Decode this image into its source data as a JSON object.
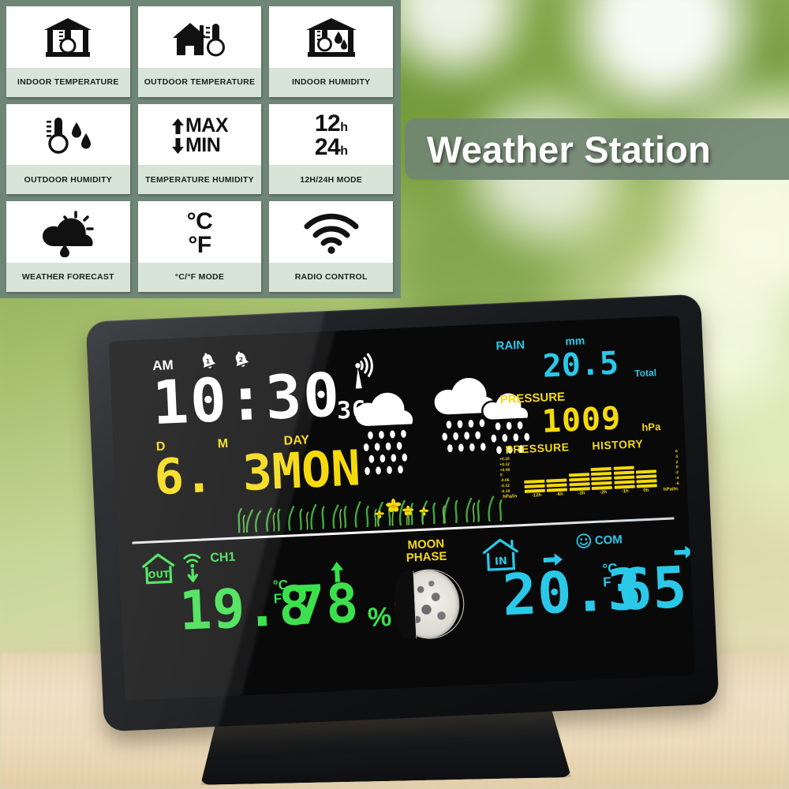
{
  "banner": {
    "title": "Weather Station",
    "bg_color": "#718572",
    "text_color": "#ffffff"
  },
  "features": [
    {
      "icon": "indoor-thermometer-icon",
      "label": "INDOOR TEMPERATURE"
    },
    {
      "icon": "house-thermometer-icon",
      "label": "OUTDOOR TEMPERATURE"
    },
    {
      "icon": "indoor-humidity-icon",
      "label": "INDOOR HUMIDITY"
    },
    {
      "icon": "thermometer-droplets-icon",
      "label": "OUTDOOR HUMIDITY"
    },
    {
      "icon": "max-min-arrows-icon",
      "label": "TEMPERATURE HUMIDITY",
      "glyph_top": "MAX",
      "glyph_bottom": "MIN"
    },
    {
      "icon": "clock-mode-icon",
      "label": "12H/24H MODE",
      "glyph_top": "12",
      "glyph_top_sub": "h",
      "glyph_bottom": "24",
      "glyph_bottom_sub": "h"
    },
    {
      "icon": "sun-cloud-rain-icon",
      "label": "WEATHER FORECAST"
    },
    {
      "icon": "celsius-fahrenheit-icon",
      "label": "°C/°F MODE",
      "glyph_top": "°C",
      "glyph_bottom": "°F"
    },
    {
      "icon": "radio-wave-icon",
      "label": "RADIO CONTROL"
    }
  ],
  "device": {
    "display": {
      "clock": {
        "ampm": "AM",
        "time": "10:30",
        "seconds": "36",
        "alarm1": "1",
        "alarm2": "2",
        "radio_icon": "radio-tower-icon"
      },
      "date": {
        "day_tag": "D",
        "month_tag": "M",
        "weekday_tag": "DAY",
        "value": "6. 3MON",
        "day": "6",
        "month": "3",
        "weekday": "MON"
      },
      "forecast": {
        "icon_left": "rain-cloud-icon",
        "icon_right": "heavy-rain-cloud-icon"
      },
      "rain": {
        "label": "RAIN",
        "unit": "mm",
        "value": "20.5",
        "suffix": "Total",
        "color": "#27c8e8"
      },
      "pressure": {
        "label": "PRESSURE",
        "value": "1009",
        "unit": "hPa",
        "color": "#f5d90a"
      },
      "pressure_history": {
        "label_left": "PRESSURE",
        "label_right": "HISTORY",
        "unit_label": "hPa/in",
        "y_left": [
          "+0.18",
          "+0.12",
          "+0.06",
          "0",
          "-0.06",
          "-0.12",
          "-0.18"
        ],
        "y_right": [
          "6",
          "4",
          "2",
          "0",
          "-2",
          "-4",
          "-6"
        ],
        "x_labels": [
          "-12h",
          "-6h",
          "-3h",
          "-2h",
          "-1h",
          "0h"
        ],
        "bar_segments": [
          3,
          3,
          4,
          5,
          5,
          4
        ]
      },
      "outdoor": {
        "location_icon": "house-out-icon",
        "location_text": "OUT",
        "signal_icon": "signal-down-icon",
        "channel": "CH1",
        "trend_icon": "arrow-up-icon",
        "temperature": "19.8",
        "temp_unit_top": "°C",
        "temp_unit_bottom": "F",
        "humidity": "78",
        "humidity_unit": "%",
        "color": "#3ae04a"
      },
      "moon": {
        "label_line1": "MOON",
        "label_line2": "PHASE",
        "phase_icon": "waxing-gibbous-moon-icon"
      },
      "indoor": {
        "location_icon": "house-in-icon",
        "location_text": "IN",
        "comfort_icon": "smiley-icon",
        "comfort_text": "COM",
        "trend_icon_left": "arrow-right-icon",
        "trend_icon_right": "arrow-right-icon",
        "temperature": "20.3",
        "temp_unit_top": "°C",
        "temp_unit_bottom": "F",
        "humidity": "65",
        "humidity_unit": "%",
        "color": "#27c8e8"
      }
    }
  },
  "chart_data": {
    "type": "bar",
    "title": "PRESSURE HISTORY",
    "categories": [
      "-12h",
      "-6h",
      "-3h",
      "-2h",
      "-1h",
      "0h"
    ],
    "values": [
      3,
      3,
      4,
      5,
      5,
      4
    ],
    "xlabel": "hPa/in",
    "ylabel": "hPa/in",
    "ylim": [
      -0.18,
      0.18
    ],
    "ytick_labels_left": [
      "+0.18",
      "+0.12",
      "+0.06",
      "0",
      "-0.06",
      "-0.12",
      "-0.18"
    ],
    "ytick_labels_right": [
      "6",
      "4",
      "2",
      "0",
      "-2",
      "-4",
      "-6"
    ],
    "grid": false,
    "legend": "none",
    "series_color": "#f5d90a"
  }
}
